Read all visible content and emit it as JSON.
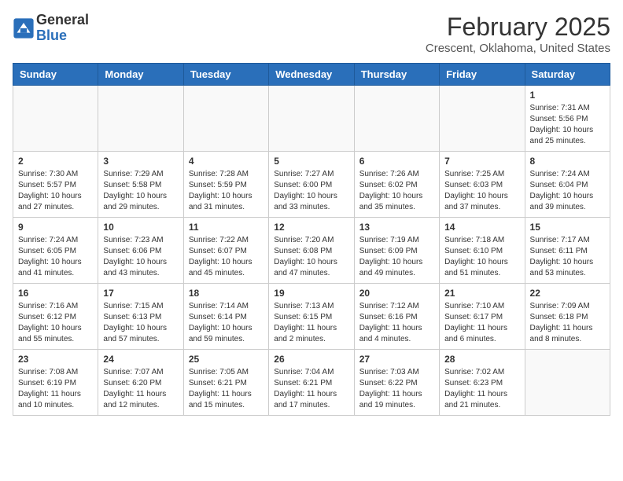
{
  "logo": {
    "general": "General",
    "blue": "Blue"
  },
  "title": "February 2025",
  "subtitle": "Crescent, Oklahoma, United States",
  "days_of_week": [
    "Sunday",
    "Monday",
    "Tuesday",
    "Wednesday",
    "Thursday",
    "Friday",
    "Saturday"
  ],
  "weeks": [
    [
      {
        "day": "",
        "info": ""
      },
      {
        "day": "",
        "info": ""
      },
      {
        "day": "",
        "info": ""
      },
      {
        "day": "",
        "info": ""
      },
      {
        "day": "",
        "info": ""
      },
      {
        "day": "",
        "info": ""
      },
      {
        "day": "1",
        "info": "Sunrise: 7:31 AM\nSunset: 5:56 PM\nDaylight: 10 hours and 25 minutes."
      }
    ],
    [
      {
        "day": "2",
        "info": "Sunrise: 7:30 AM\nSunset: 5:57 PM\nDaylight: 10 hours and 27 minutes."
      },
      {
        "day": "3",
        "info": "Sunrise: 7:29 AM\nSunset: 5:58 PM\nDaylight: 10 hours and 29 minutes."
      },
      {
        "day": "4",
        "info": "Sunrise: 7:28 AM\nSunset: 5:59 PM\nDaylight: 10 hours and 31 minutes."
      },
      {
        "day": "5",
        "info": "Sunrise: 7:27 AM\nSunset: 6:00 PM\nDaylight: 10 hours and 33 minutes."
      },
      {
        "day": "6",
        "info": "Sunrise: 7:26 AM\nSunset: 6:02 PM\nDaylight: 10 hours and 35 minutes."
      },
      {
        "day": "7",
        "info": "Sunrise: 7:25 AM\nSunset: 6:03 PM\nDaylight: 10 hours and 37 minutes."
      },
      {
        "day": "8",
        "info": "Sunrise: 7:24 AM\nSunset: 6:04 PM\nDaylight: 10 hours and 39 minutes."
      }
    ],
    [
      {
        "day": "9",
        "info": "Sunrise: 7:24 AM\nSunset: 6:05 PM\nDaylight: 10 hours and 41 minutes."
      },
      {
        "day": "10",
        "info": "Sunrise: 7:23 AM\nSunset: 6:06 PM\nDaylight: 10 hours and 43 minutes."
      },
      {
        "day": "11",
        "info": "Sunrise: 7:22 AM\nSunset: 6:07 PM\nDaylight: 10 hours and 45 minutes."
      },
      {
        "day": "12",
        "info": "Sunrise: 7:20 AM\nSunset: 6:08 PM\nDaylight: 10 hours and 47 minutes."
      },
      {
        "day": "13",
        "info": "Sunrise: 7:19 AM\nSunset: 6:09 PM\nDaylight: 10 hours and 49 minutes."
      },
      {
        "day": "14",
        "info": "Sunrise: 7:18 AM\nSunset: 6:10 PM\nDaylight: 10 hours and 51 minutes."
      },
      {
        "day": "15",
        "info": "Sunrise: 7:17 AM\nSunset: 6:11 PM\nDaylight: 10 hours and 53 minutes."
      }
    ],
    [
      {
        "day": "16",
        "info": "Sunrise: 7:16 AM\nSunset: 6:12 PM\nDaylight: 10 hours and 55 minutes."
      },
      {
        "day": "17",
        "info": "Sunrise: 7:15 AM\nSunset: 6:13 PM\nDaylight: 10 hours and 57 minutes."
      },
      {
        "day": "18",
        "info": "Sunrise: 7:14 AM\nSunset: 6:14 PM\nDaylight: 10 hours and 59 minutes."
      },
      {
        "day": "19",
        "info": "Sunrise: 7:13 AM\nSunset: 6:15 PM\nDaylight: 11 hours and 2 minutes."
      },
      {
        "day": "20",
        "info": "Sunrise: 7:12 AM\nSunset: 6:16 PM\nDaylight: 11 hours and 4 minutes."
      },
      {
        "day": "21",
        "info": "Sunrise: 7:10 AM\nSunset: 6:17 PM\nDaylight: 11 hours and 6 minutes."
      },
      {
        "day": "22",
        "info": "Sunrise: 7:09 AM\nSunset: 6:18 PM\nDaylight: 11 hours and 8 minutes."
      }
    ],
    [
      {
        "day": "23",
        "info": "Sunrise: 7:08 AM\nSunset: 6:19 PM\nDaylight: 11 hours and 10 minutes."
      },
      {
        "day": "24",
        "info": "Sunrise: 7:07 AM\nSunset: 6:20 PM\nDaylight: 11 hours and 12 minutes."
      },
      {
        "day": "25",
        "info": "Sunrise: 7:05 AM\nSunset: 6:21 PM\nDaylight: 11 hours and 15 minutes."
      },
      {
        "day": "26",
        "info": "Sunrise: 7:04 AM\nSunset: 6:21 PM\nDaylight: 11 hours and 17 minutes."
      },
      {
        "day": "27",
        "info": "Sunrise: 7:03 AM\nSunset: 6:22 PM\nDaylight: 11 hours and 19 minutes."
      },
      {
        "day": "28",
        "info": "Sunrise: 7:02 AM\nSunset: 6:23 PM\nDaylight: 11 hours and 21 minutes."
      },
      {
        "day": "",
        "info": ""
      }
    ]
  ]
}
